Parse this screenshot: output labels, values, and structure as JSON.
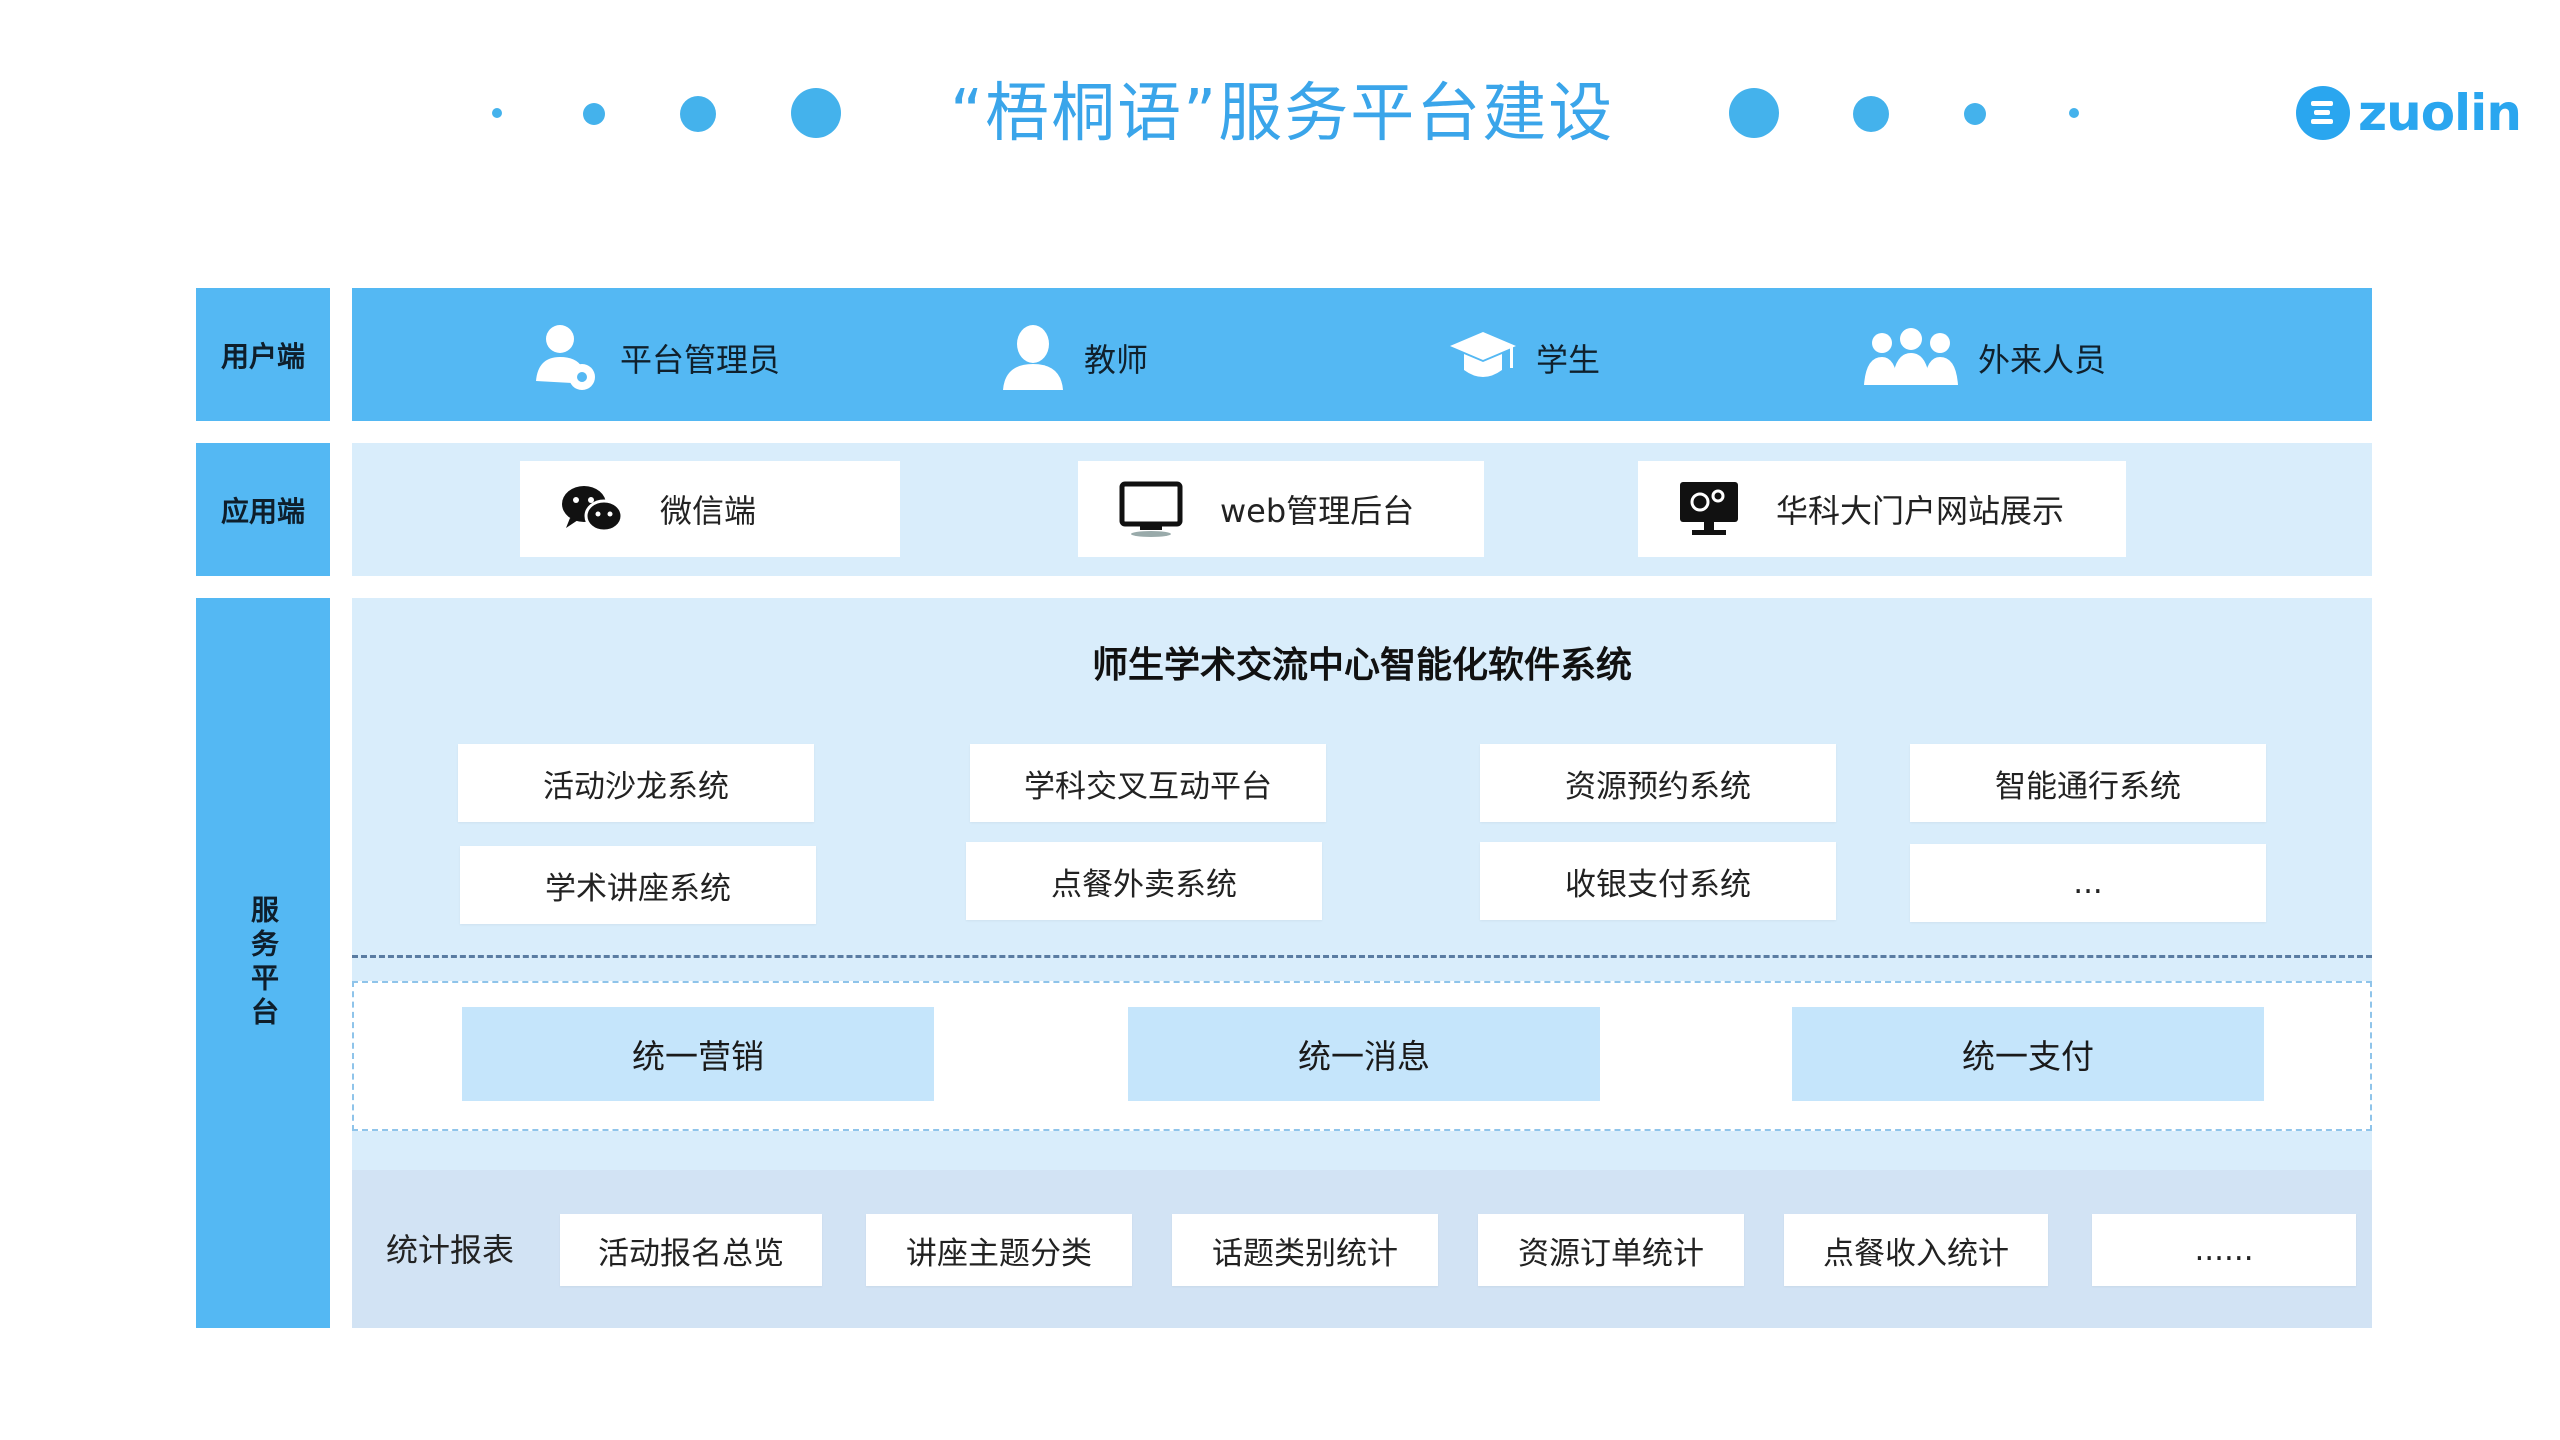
{
  "title": "“梧桐语”服务平台建设",
  "logo": {
    "text": "zuolin",
    "color": "#2aa6ef"
  },
  "colors": {
    "accent": "#3aa5ea",
    "label_bg": "#54b8f3",
    "panel_bg": "#d9edfb",
    "stat_bg": "#d2e3f4",
    "uni_bg": "#c5e5fb"
  },
  "labels": {
    "user": "用户端",
    "app": "应用端",
    "service": "服务平台"
  },
  "users": [
    {
      "label": "平台管理员",
      "icon": "admin-gear-icon"
    },
    {
      "label": "教师",
      "icon": "person-icon"
    },
    {
      "label": "学生",
      "icon": "graduation-cap-icon"
    },
    {
      "label": "外来人员",
      "icon": "group-icon"
    }
  ],
  "apps": [
    {
      "label": "微信端",
      "icon": "wechat-icon"
    },
    {
      "label": "web管理后台",
      "icon": "monitor-icon"
    },
    {
      "label": "华科大门户网站展示",
      "icon": "website-screen-icon"
    }
  ],
  "system_title": "师生学术交流中心智能化软件系统",
  "systems": [
    "活动沙龙系统",
    "学科交叉互动平台",
    "资源预约系统",
    "智能通行系统",
    "学术讲座系统",
    "点餐外卖系统",
    "收银支付系统",
    "..."
  ],
  "unified": [
    "统一营销",
    "统一消息",
    "统一支付"
  ],
  "stats": {
    "label": "统计报表",
    "items": [
      "活动报名总览",
      "讲座主题分类",
      "话题类别统计",
      "资源订单统计",
      "点餐收入统计",
      "......"
    ]
  }
}
